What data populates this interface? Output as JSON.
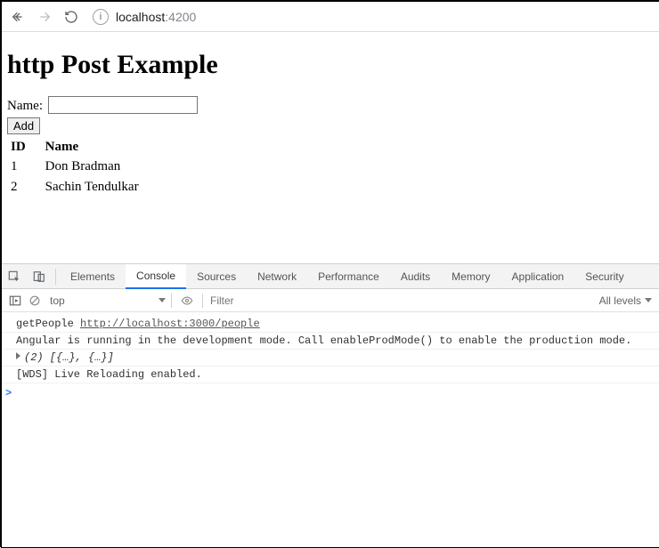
{
  "chrome": {
    "url_host": "localhost",
    "url_port": ":4200",
    "info_glyph": "i"
  },
  "page": {
    "heading": "http Post Example",
    "form": {
      "name_label": "Name:",
      "name_value": "",
      "add_label": "Add"
    },
    "table": {
      "headers": {
        "id": "ID",
        "name": "Name"
      },
      "rows": [
        {
          "id": "1",
          "name": "Don Bradman"
        },
        {
          "id": "2",
          "name": "Sachin Tendulkar"
        }
      ]
    }
  },
  "devtools": {
    "tabs": {
      "elements": "Elements",
      "console": "Console",
      "sources": "Sources",
      "network": "Network",
      "performance": "Performance",
      "audits": "Audits",
      "memory": "Memory",
      "application": "Application",
      "security": "Security"
    },
    "toolbar": {
      "context": "top",
      "filter_placeholder": "Filter",
      "levels": "All levels"
    },
    "console": {
      "line1_prefix": "getPeople ",
      "line1_url": "http://localhost:3000/people",
      "line2": "Angular is running in the development mode. Call enableProdMode() to enable the production mode.",
      "line3": "(2) [{…}, {…}]",
      "line4": "[WDS] Live Reloading enabled.",
      "prompt": ">"
    }
  }
}
